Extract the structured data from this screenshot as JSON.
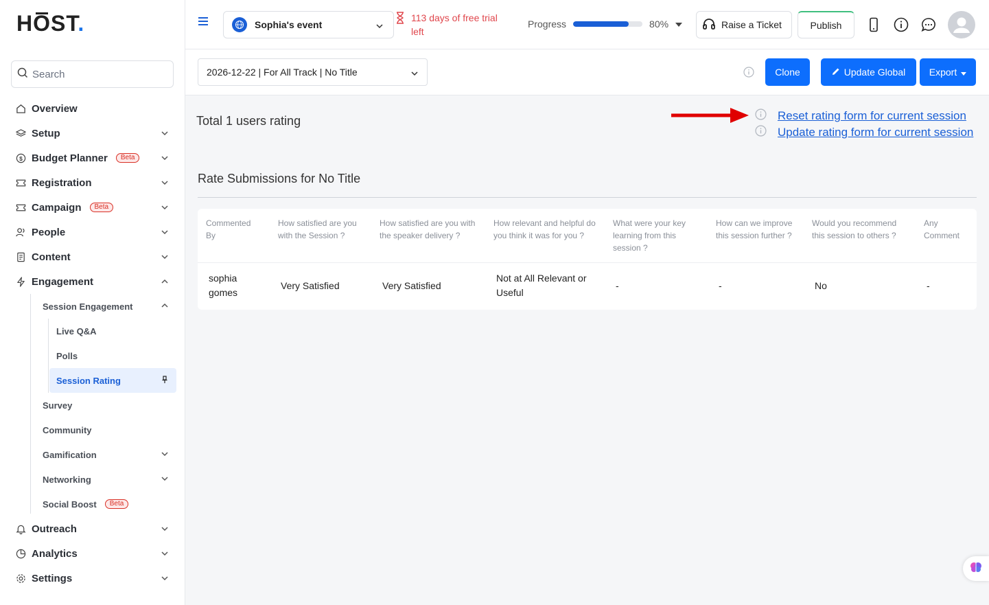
{
  "brand": {
    "logo_h": "H",
    "logo_o": "O",
    "logo_st": "ST",
    "logo_dot": ".",
    "accent": "#0d6efd"
  },
  "sidebar": {
    "search_placeholder": "Search",
    "items": [
      {
        "label": "Overview"
      },
      {
        "label": "Setup"
      },
      {
        "label": "Budget Planner",
        "badge": "Beta"
      },
      {
        "label": "Registration"
      },
      {
        "label": "Campaign",
        "badge": "Beta"
      },
      {
        "label": "People"
      },
      {
        "label": "Content"
      },
      {
        "label": "Engagement"
      },
      {
        "label": "Outreach"
      },
      {
        "label": "Analytics"
      },
      {
        "label": "Settings"
      }
    ],
    "engagement_sub": [
      {
        "label": "Session Engagement"
      },
      {
        "label": "Survey"
      },
      {
        "label": "Community"
      },
      {
        "label": "Gamification"
      },
      {
        "label": "Networking"
      },
      {
        "label": "Social Boost",
        "badge": "Beta"
      }
    ],
    "session_engagement_sub": [
      {
        "label": "Live Q&A"
      },
      {
        "label": "Polls"
      },
      {
        "label": "Session Rating"
      }
    ]
  },
  "topbar": {
    "event_name": "Sophia's event",
    "trial_text": "113 days of free trial left",
    "progress_label": "Progress",
    "progress_value": 80,
    "progress_text": "80%",
    "raise_ticket": "Raise a Ticket",
    "publish": "Publish"
  },
  "subheader": {
    "session_value": "2026-12-22 | For All Track | No Title",
    "clone": "Clone",
    "update_global": "Update Global",
    "export": "Export"
  },
  "main": {
    "total_label": "Total 1 users rating",
    "reset_link": "Reset rating form for current session",
    "update_link": "Update rating form for current session",
    "section_title": "Rate Submissions for No Title",
    "table": {
      "headers": [
        "Commented By",
        "How satisfied are you with the Session ?",
        "How satisfied are you with the speaker delivery ?",
        "How relevant and helpful do you think it was for you ?",
        "What were your key learning from this session ?",
        "How can we improve this session further ?",
        "Would you recommend this session to others ?",
        "Any Comment"
      ],
      "rows": [
        [
          "sophia gomes",
          "Very Satisfied",
          "Very Satisfied",
          "Not at All Relevant or Useful",
          "-",
          "-",
          "No",
          "-"
        ]
      ]
    }
  }
}
